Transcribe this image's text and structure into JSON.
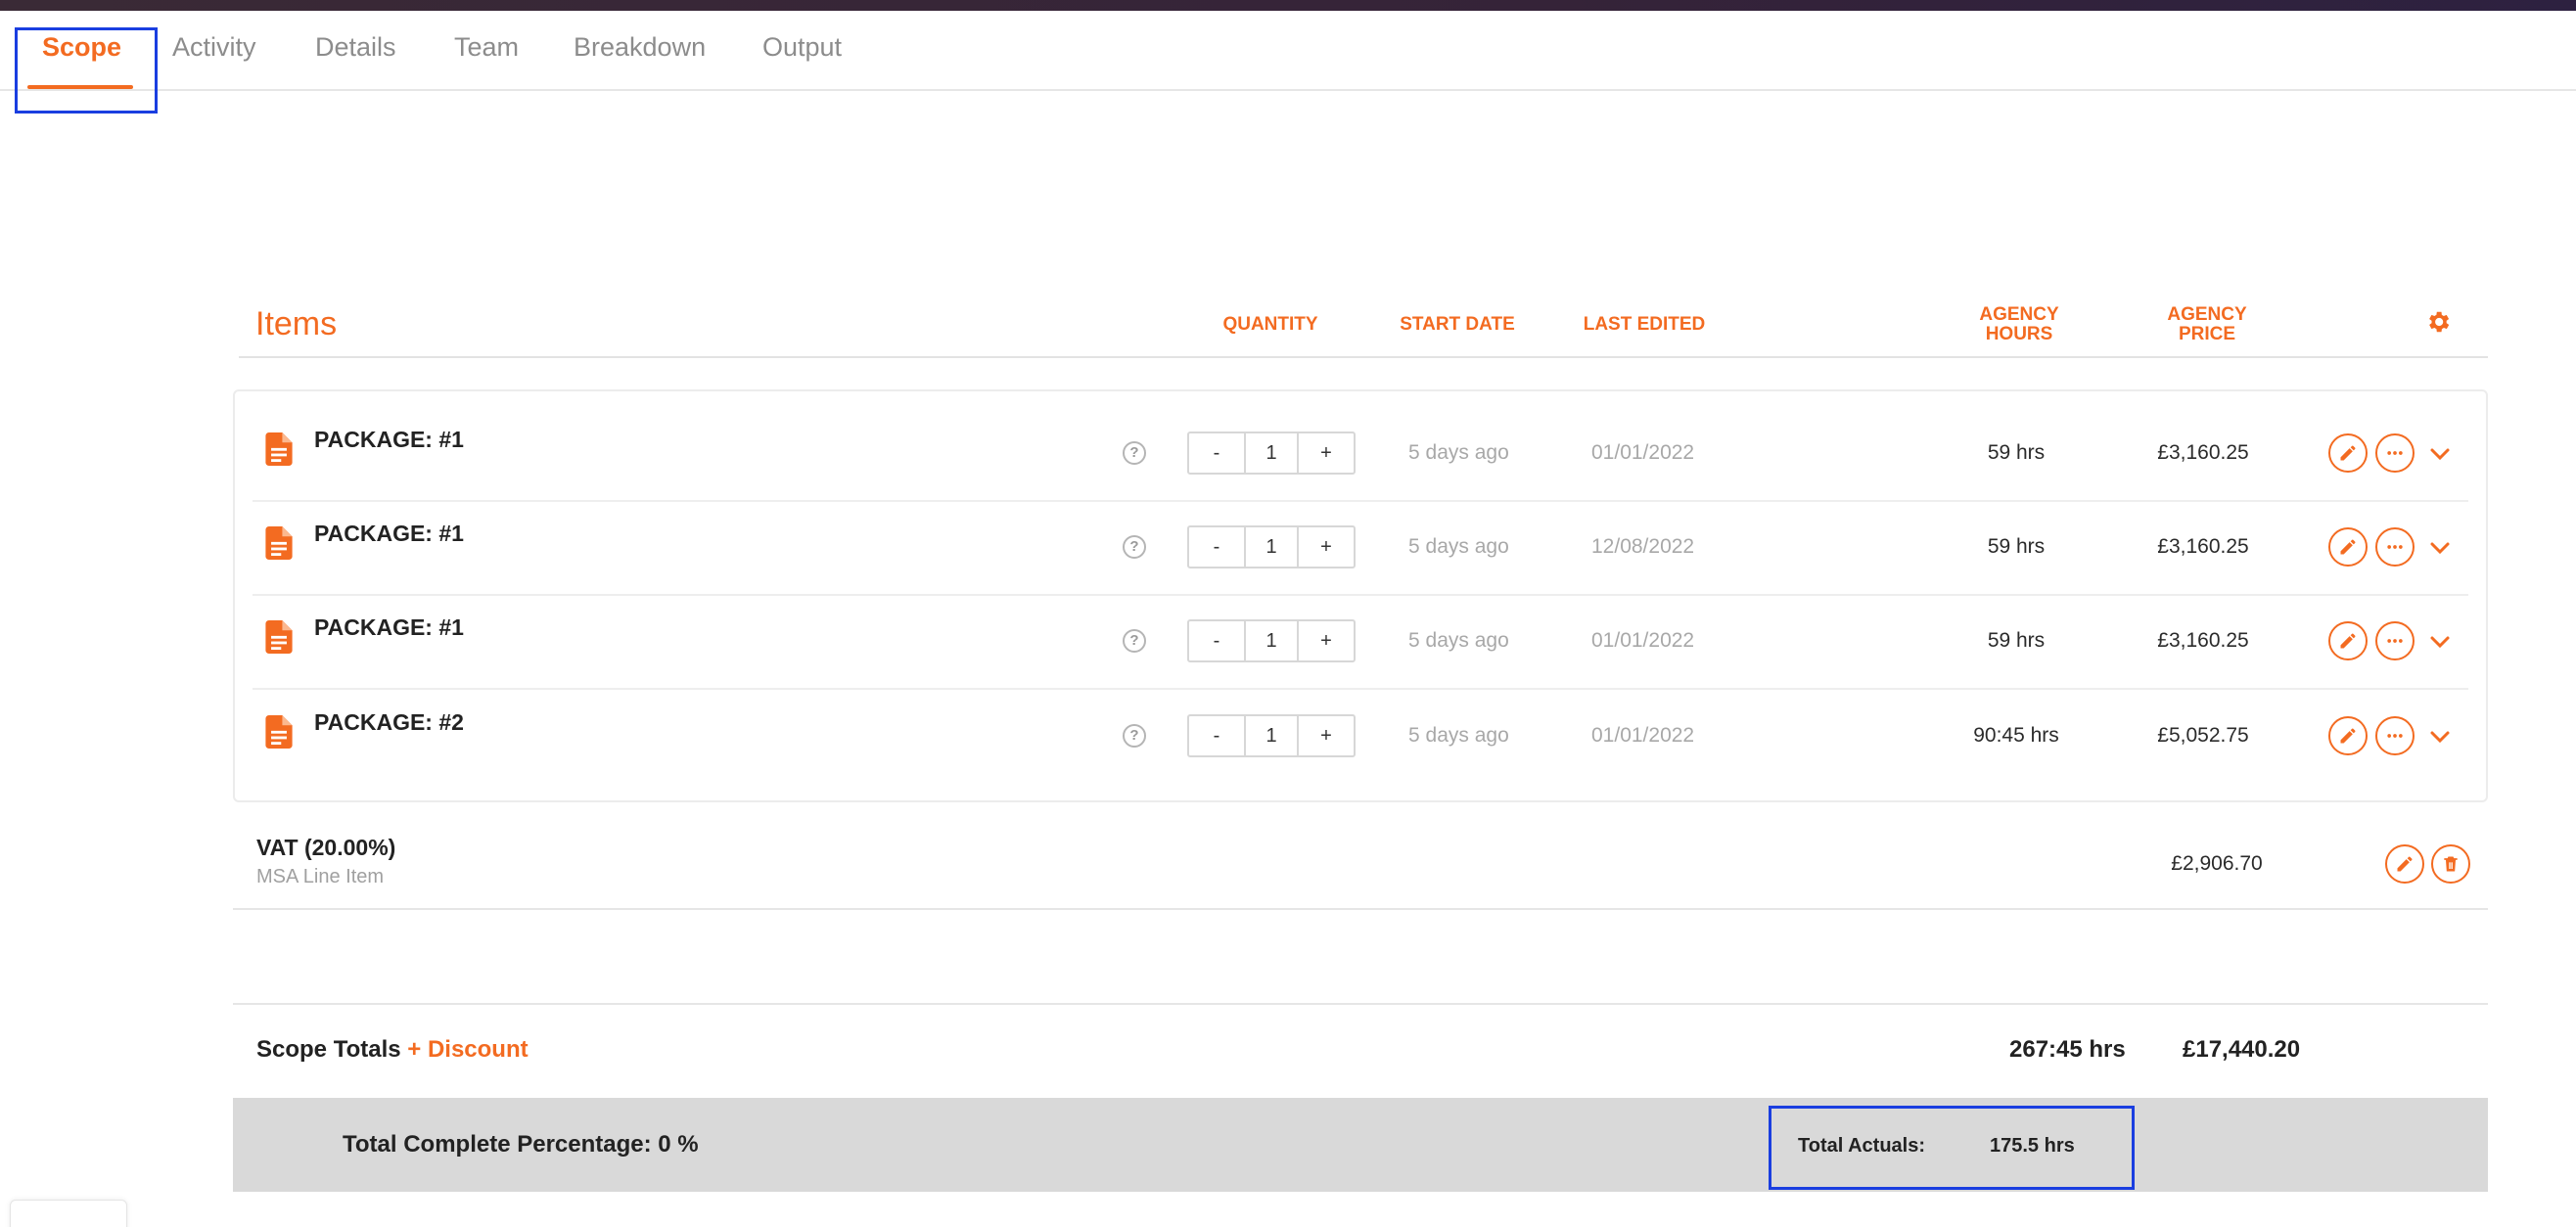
{
  "tabs": [
    {
      "label": "Scope",
      "active": true
    },
    {
      "label": "Activity",
      "active": false
    },
    {
      "label": "Details",
      "active": false
    },
    {
      "label": "Team",
      "active": false
    },
    {
      "label": "Breakdown",
      "active": false
    },
    {
      "label": "Output",
      "active": false
    }
  ],
  "items_header": {
    "title": "Items",
    "columns": {
      "quantity": "QUANTITY",
      "start_date": "START DATE",
      "last_edited": "LAST EDITED",
      "agency_hours_1": "AGENCY",
      "agency_hours_2": "HOURS",
      "agency_price_1": "AGENCY",
      "agency_price_2": "PRICE"
    },
    "settings_icon": "gear-icon"
  },
  "items": [
    {
      "name": "PACKAGE: #1",
      "quantity": "1",
      "start_date": "5 days ago",
      "last_edited": "01/01/2022",
      "hours": "59 hrs",
      "price": "£3,160.25"
    },
    {
      "name": "PACKAGE: #1",
      "quantity": "1",
      "start_date": "5 days ago",
      "last_edited": "12/08/2022",
      "hours": "59 hrs",
      "price": "£3,160.25"
    },
    {
      "name": "PACKAGE: #1",
      "quantity": "1",
      "start_date": "5 days ago",
      "last_edited": "01/01/2022",
      "hours": "59 hrs",
      "price": "£3,160.25"
    },
    {
      "name": "PACKAGE: #2",
      "quantity": "1",
      "start_date": "5 days ago",
      "last_edited": "01/01/2022",
      "hours": "90:45 hrs",
      "price": "£5,052.75"
    }
  ],
  "stepper": {
    "minus": "-",
    "plus": "+"
  },
  "help_glyph": "?",
  "vat": {
    "title": "VAT (20.00%)",
    "subtitle": "MSA Line Item",
    "amount": "£2,906.70"
  },
  "totals": {
    "label": "Scope Totals",
    "discount_link": "+ Discount",
    "hours": "267:45 hrs",
    "price": "£17,440.20"
  },
  "completion": {
    "label": "Total Complete Percentage: 0 %",
    "actuals_label": "Total Actuals:",
    "actuals_value": "175.5 hrs"
  },
  "colors": {
    "accent": "#f36b21",
    "highlight": "#1a3ee0",
    "band": "#d9d9d9"
  }
}
